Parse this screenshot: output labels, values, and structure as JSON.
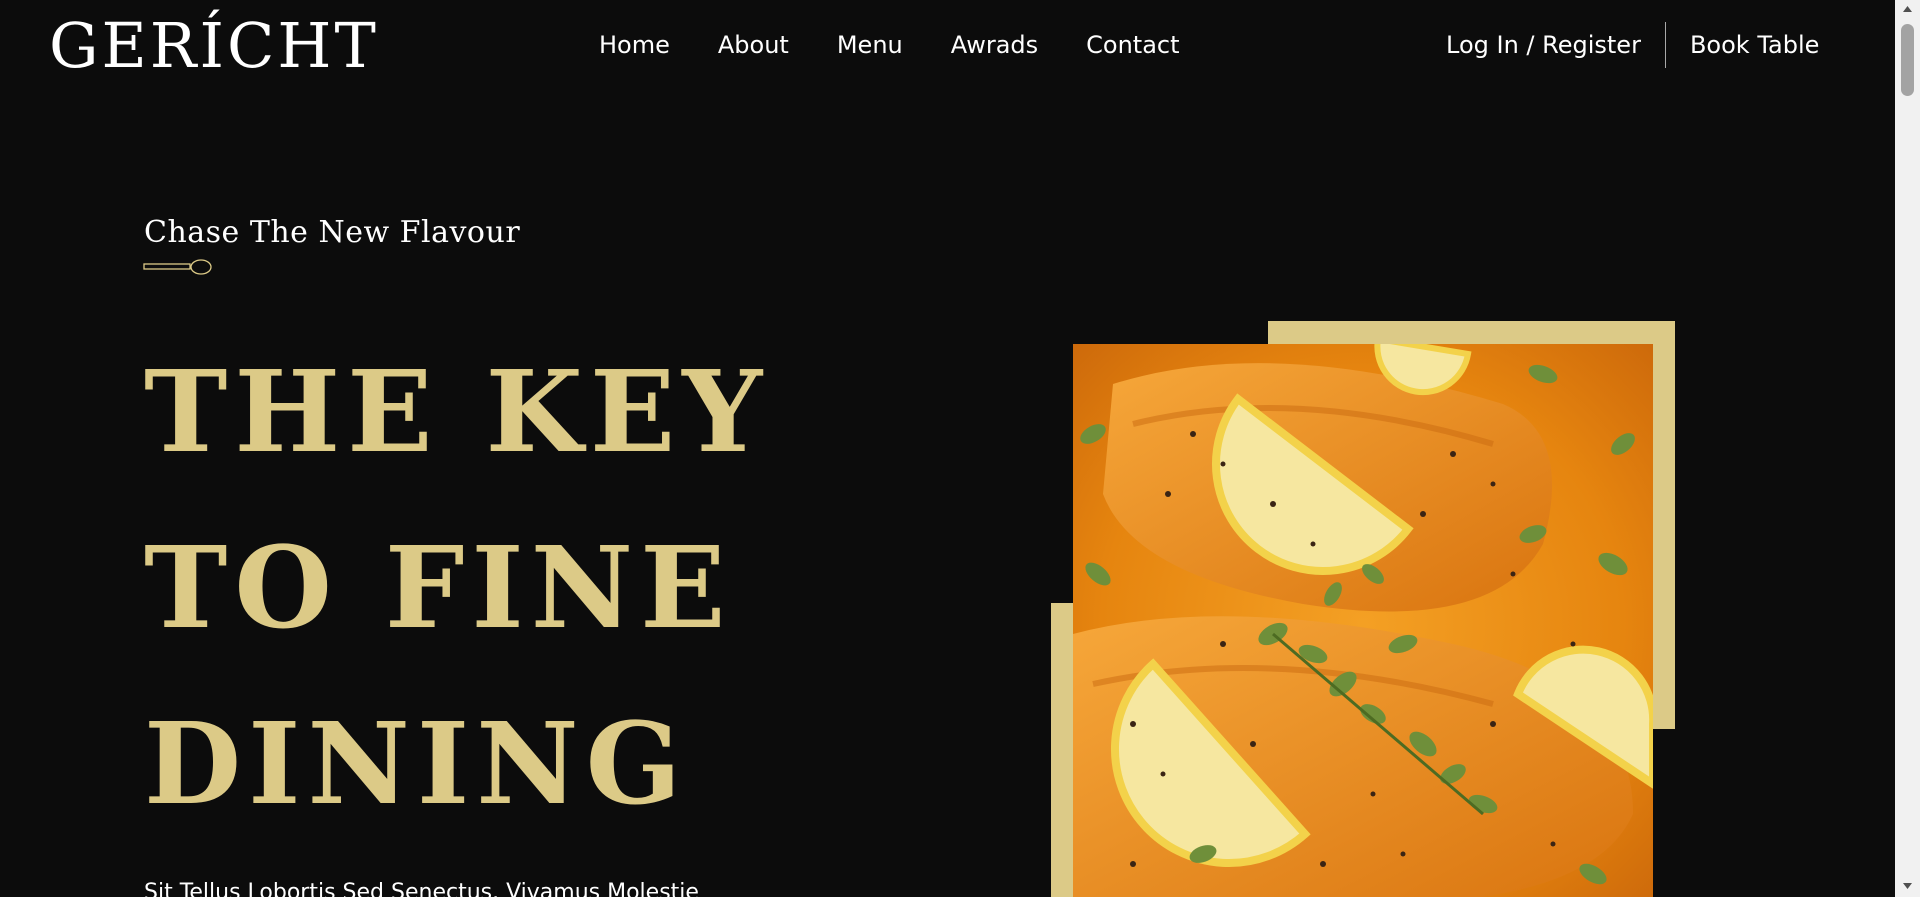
{
  "navbar": {
    "logo": "GERÍCHT",
    "links": [
      {
        "label": "Home"
      },
      {
        "label": "About"
      },
      {
        "label": "Menu"
      },
      {
        "label": "Awrads"
      },
      {
        "label": "Contact"
      }
    ],
    "login_label": "Log In / Register",
    "book_label": "Book Table"
  },
  "hero": {
    "subtitle": "Chase The New Flavour",
    "headline": [
      "THE KEY",
      "TO FINE",
      "DINING"
    ],
    "description": "Sit Tellus Lobortis Sed Senectus. Vivamus Molestie",
    "icons": {
      "spoon": "spoon-icon"
    },
    "image_subject": "Salmon with lemon slices and oregano"
  },
  "colors": {
    "background": "#0c0c0c",
    "accent_gold": "#dcca87",
    "text": "#ffffff"
  }
}
